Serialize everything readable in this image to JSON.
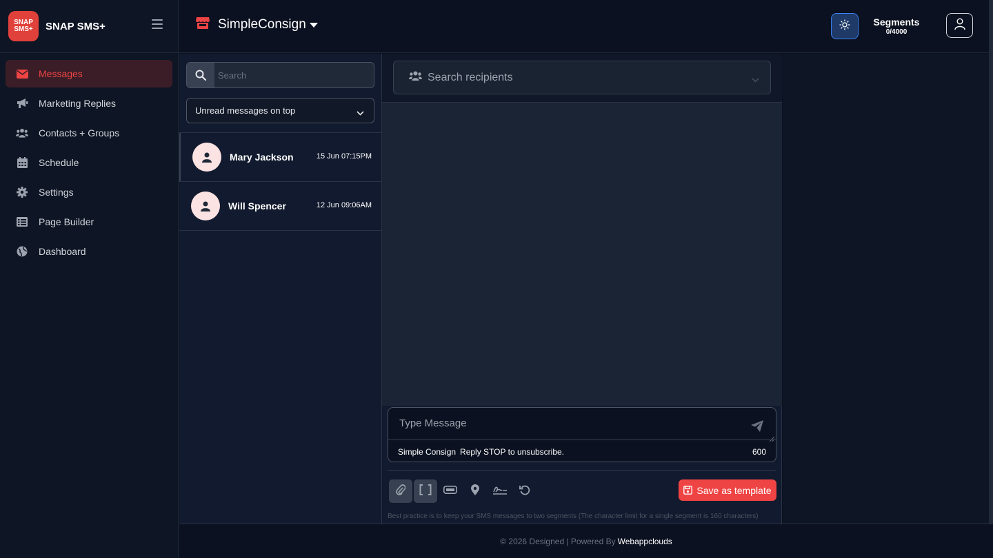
{
  "brand": {
    "logo_line1": "SNAP",
    "logo_line2": "SMS+",
    "name": "SNAP SMS+"
  },
  "sidebar": {
    "items": [
      {
        "label": "Messages",
        "icon": "envelope-icon",
        "active": true
      },
      {
        "label": "Marketing Replies",
        "icon": "megaphone-icon"
      },
      {
        "label": "Contacts + Groups",
        "icon": "users-icon"
      },
      {
        "label": "Schedule",
        "icon": "calendar-icon"
      },
      {
        "label": "Settings",
        "icon": "gear-icon"
      },
      {
        "label": "Page Builder",
        "icon": "list-icon"
      },
      {
        "label": "Dashboard",
        "icon": "globe-icon"
      }
    ]
  },
  "header": {
    "store_name": "SimpleConsign",
    "segments_title": "Segments",
    "segments_value": "0/4000"
  },
  "conversations": {
    "search_placeholder": "Search",
    "sort_label": "Unread messages on top",
    "items": [
      {
        "name": "Mary Jackson",
        "time": "15 Jun 07:15PM"
      },
      {
        "name": "Will Spencer",
        "time": "12 Jun 09:06AM"
      }
    ]
  },
  "chat": {
    "recipients_placeholder": "Search recipients",
    "message_placeholder": "Type Message",
    "signature": "Simple Consign",
    "optout": "Reply STOP to unsubscribe.",
    "char_count": "600",
    "save_template_label": "Save as template",
    "hint": "Best practice is to keep your SMS messages to two segments (The character limit for a single segment is 160 characters)"
  },
  "footer": {
    "text": "© 2026 Designed | Powered By",
    "link": "Webappclouds"
  },
  "colors": {
    "accent": "#ef4444",
    "background": "#0b1120",
    "panel": "#111a2e"
  }
}
